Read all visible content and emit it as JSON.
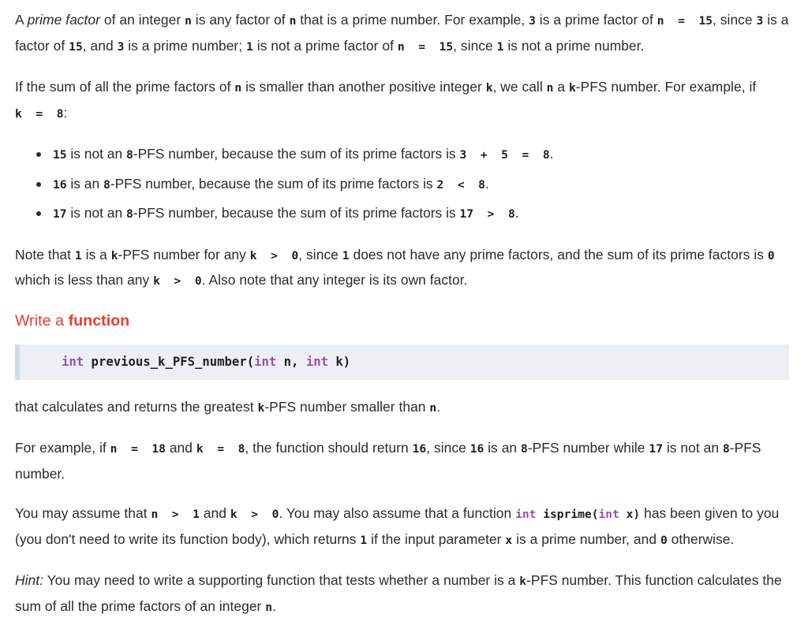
{
  "document": {
    "type": "programming-exercise",
    "colors": {
      "text": "#2b2b2b",
      "heading_red": "#ea3c28",
      "code_keyword_purple": "#9d4eab",
      "codeblock_bg": "#eceff4",
      "codeblock_border": "#cedce6",
      "page_bg": "#ffffff"
    }
  },
  "paragraphs": {
    "p1": {
      "s1": "A ",
      "em1": "prime factor",
      "s2": " of an integer ",
      "c1": "n",
      "s3": " is any factor of ",
      "c2": "n",
      "s4": " that is a prime number. For example, ",
      "c3": "3",
      "s5": " is a prime factor of ",
      "c4": "n  =  15",
      "s6": ", since ",
      "c5": "3",
      "s7": " is a factor of ",
      "c6": "15",
      "s8": ", and ",
      "c7": "3",
      "s9": " is a prime number; ",
      "c8": "1",
      "s10": " is not a prime factor of ",
      "c9": "n  =  15",
      "s11": ", since ",
      "c10": "1",
      "s12": " is not a prime number."
    },
    "p2": {
      "s1": "If the sum of all the prime factors of ",
      "c1": "n",
      "s2": " is smaller than another positive integer ",
      "c2": "k",
      "s3": ", we call ",
      "c3": "n",
      "s4": " a ",
      "c4": "k",
      "s5": "-PFS number. For example, if ",
      "c5": "k  =  8",
      "s6": ":"
    },
    "p3": {
      "s1": "Note that ",
      "c1": "1",
      "s2": " is a ",
      "c2": "k",
      "s3": "-PFS number for any ",
      "c3": "k  >  0",
      "s4": ", since ",
      "c4": "1",
      "s5": " does not have any prime factors, and the sum of its prime factors is ",
      "c5": "0",
      "s6": " which is less than any ",
      "c6": "k  >  0",
      "s7": ". Also note that any integer is its own factor."
    },
    "p4": {
      "s1": "that calculates and returns the greatest ",
      "c1": "k",
      "s2": "-PFS number smaller than ",
      "c2": "n",
      "s3": "."
    },
    "p5": {
      "s1": "For example, if ",
      "c1": "n  =  18",
      "s2": " and ",
      "c2": "k  =  8",
      "s3": ", the function should return ",
      "c3": "16",
      "s4": ", since ",
      "c4": "16",
      "s5": " is an ",
      "c5": "8",
      "s6": "-PFS number while ",
      "c6": "17",
      "s7": " is not an ",
      "c7": "8",
      "s8": "-PFS number."
    },
    "p6": {
      "s1": "You may assume that ",
      "c1": "n  >  1",
      "s2": " and ",
      "c2": "k  >  0",
      "s3": ". You may also assume that a function ",
      "code_kw1": "int",
      "code_mid1": " isprime(",
      "code_kw2": "int",
      "code_mid2": " x)",
      "s4": " has been given to you (you don't need to write its function body), which returns ",
      "c3": "1",
      "s5": " if the input parameter ",
      "c4": "x",
      "s6": " is a prime number, and ",
      "c5": "0",
      "s7": " otherwise."
    },
    "p7": {
      "em1": "Hint:",
      "s1": " You may need to write a supporting function that tests whether a number is a ",
      "c1": "k",
      "s2": "-PFS number. This function calculates the sum of all the prime factors of an integer ",
      "c2": "n",
      "s3": "."
    }
  },
  "bullets": [
    {
      "c1": "15",
      "s1": " is not an ",
      "c2": "8",
      "s2": "-PFS number, because the sum of its prime factors is ",
      "c3": "3  +  5  =  8",
      "s3": "."
    },
    {
      "c1": "16",
      "s1": " is an ",
      "c2": "8",
      "s2": "-PFS number, because the sum of its prime factors is ",
      "c3": "2  <  8",
      "s3": "."
    },
    {
      "c1": "17",
      "s1": " is not an ",
      "c2": "8",
      "s2": "-PFS number, because the sum of its prime factors is ",
      "c3": "17  >  8",
      "s3": "."
    }
  ],
  "heading": {
    "prefix": "Write a ",
    "strong": "function"
  },
  "codeblock": {
    "keyword": "int",
    "rest": " previous_k_PFS_number(",
    "keyword2": "int",
    "mid": " n, ",
    "keyword3": "int",
    "tail": " k)"
  }
}
